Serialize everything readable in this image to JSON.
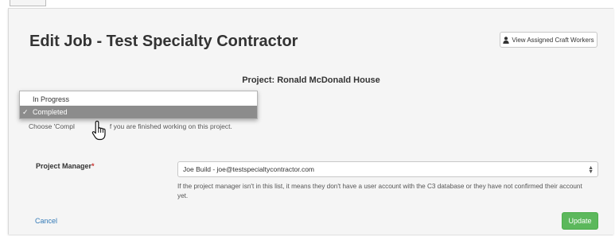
{
  "page": {
    "title": "Edit Job - Test Specialty Contractor",
    "view_workers_button": "View Assigned Craft Workers",
    "project_label": "Project: Ronald McDonald House"
  },
  "status": {
    "options": [
      "In Progress",
      "Completed"
    ],
    "selected": "Completed",
    "check_mark": "✓",
    "help_before": "Choose 'Compl",
    "help_after": "f you are finished working on this project."
  },
  "project_manager": {
    "label": "Project Manager",
    "required_mark": "*",
    "value": "Joe Build - joe@testspecialtycontractor.com",
    "help": "If the project manager isn't in this list, it means they don't have a user account with the C3 database or they have not confirmed their account yet."
  },
  "actions": {
    "cancel": "Cancel",
    "update": "Update"
  },
  "colors": {
    "update_button": "#5cb85c",
    "link": "#337ab7",
    "required": "#c9302c",
    "selected_option": "#8c8c8c"
  },
  "icons": {
    "view_workers": "user-icon",
    "cursor": "hand-pointer-icon"
  }
}
